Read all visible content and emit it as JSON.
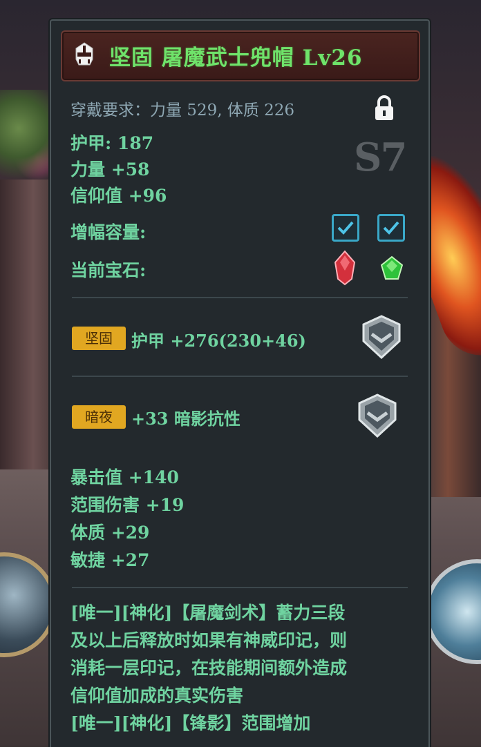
{
  "item": {
    "title": "坚固 屠魔武士兜帽 Lv26",
    "requirement": "穿戴要求：力量 529, 体质 226",
    "grade": "S7",
    "base_stats": [
      "护甲: 187",
      "力量 +58",
      "信仰值 +96"
    ],
    "slots_label": "增幅容量:",
    "gems_label": "当前宝石:",
    "gems": [
      "red-gem-icon",
      "green-gem-icon"
    ],
    "affixes": [
      {
        "tag": "坚固",
        "text": "护甲 +276(230+46)"
      },
      {
        "tag": "暗夜",
        "text": "+33 暗影抗性"
      }
    ],
    "extra_stats": [
      "暴击值 +140",
      "范围伤害 +19",
      "体质 +29",
      "敏捷 +27"
    ],
    "description_lines": [
      "[唯一][神化]【屠魔剑术】蓄力三段",
      "及以上后释放时如果有神威印记，则",
      "消耗一层印记，在技能期间额外造成",
      "信仰值加成的真实伤害",
      "[唯一][神化]【锋影】范围增加"
    ]
  },
  "colors": {
    "title": "#6fe36a",
    "stat_text": "#6fd3a0",
    "requirement_text": "#8ea7b3",
    "tag_bg": "#e1a721",
    "panel_bg": "#23292d"
  }
}
